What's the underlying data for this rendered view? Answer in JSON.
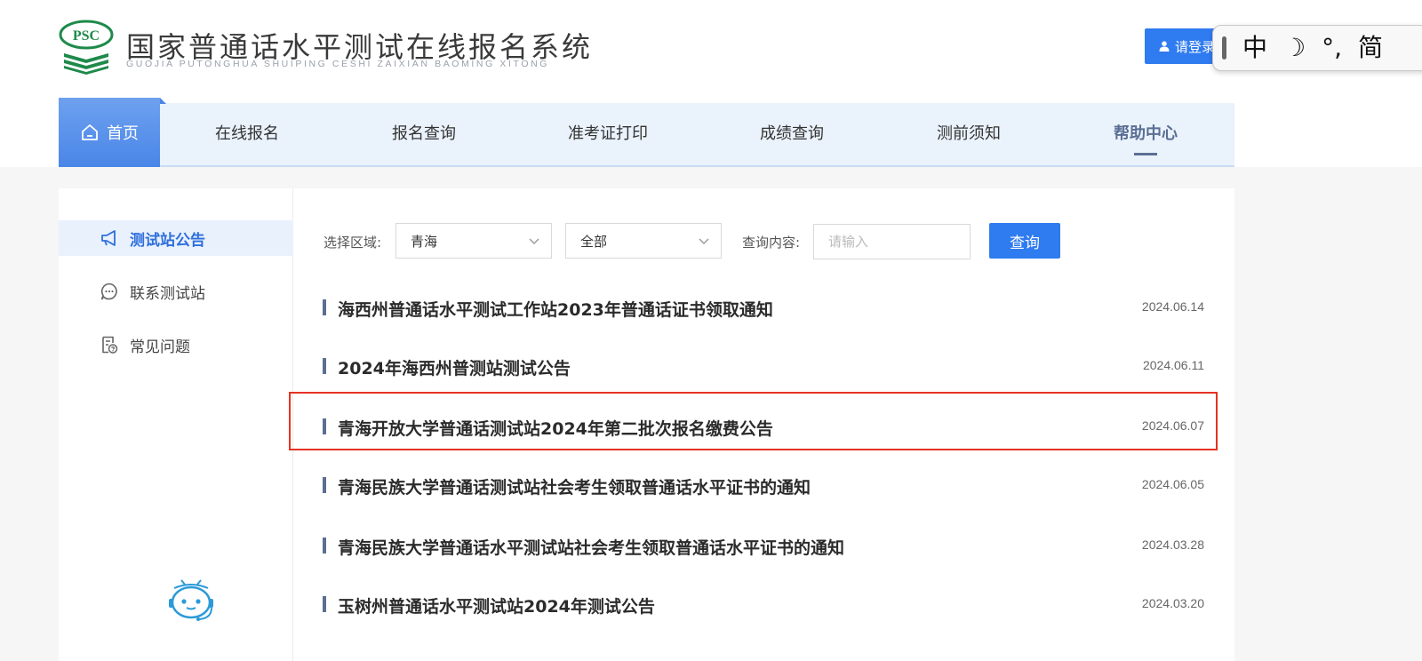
{
  "header": {
    "logo_text": "PSC",
    "title": "国家普通话水平测试在线报名系统",
    "subtitle": "GUOJIA PUTONGHUA SHUIPING CESHI ZAIXIAN BAOMING XITONG",
    "login_label": "请登录"
  },
  "ime": {
    "items": [
      "中",
      "☽",
      "°,",
      "简"
    ]
  },
  "nav": {
    "home_label": "首页",
    "items": [
      {
        "label": "在线报名"
      },
      {
        "label": "报名查询"
      },
      {
        "label": "准考证打印"
      },
      {
        "label": "成绩查询"
      },
      {
        "label": "测前须知"
      },
      {
        "label": "帮助中心",
        "active": true
      }
    ]
  },
  "sidebar": {
    "items": [
      {
        "label": "测试站公告",
        "icon": "megaphone-icon",
        "active": true
      },
      {
        "label": "联系测试站",
        "icon": "chat-icon"
      },
      {
        "label": "常见问题",
        "icon": "document-question-icon"
      }
    ]
  },
  "filter": {
    "region_label": "选择区域:",
    "region_value": "青海",
    "scope_value": "全部",
    "query_label": "查询内容:",
    "query_placeholder": "请输入",
    "query_button": "查询"
  },
  "notices": [
    {
      "title": "海西州普通话水平测试工作站2023年普通话证书领取通知",
      "date": "2024.06.14"
    },
    {
      "title": "2024年海西州普测站测试公告",
      "date": "2024.06.11"
    },
    {
      "title": "青海开放大学普通话测试站2024年第二批次报名缴费公告",
      "date": "2024.06.07",
      "highlighted": true
    },
    {
      "title": "青海民族大学普通话测试站社会考生领取普通话水平证书的通知",
      "date": "2024.06.05"
    },
    {
      "title": "青海民族大学普通话水平测试站社会考生领取普通话水平证书的通知",
      "date": "2024.03.28"
    },
    {
      "title": "玉树州普通话水平测试站2024年测试公告",
      "date": "2024.03.20"
    }
  ],
  "colors": {
    "primary": "#2f7bf0",
    "nav_bg": "#eaf2fc",
    "highlight_border": "#e63222",
    "logo_green": "#1e8a4a"
  }
}
